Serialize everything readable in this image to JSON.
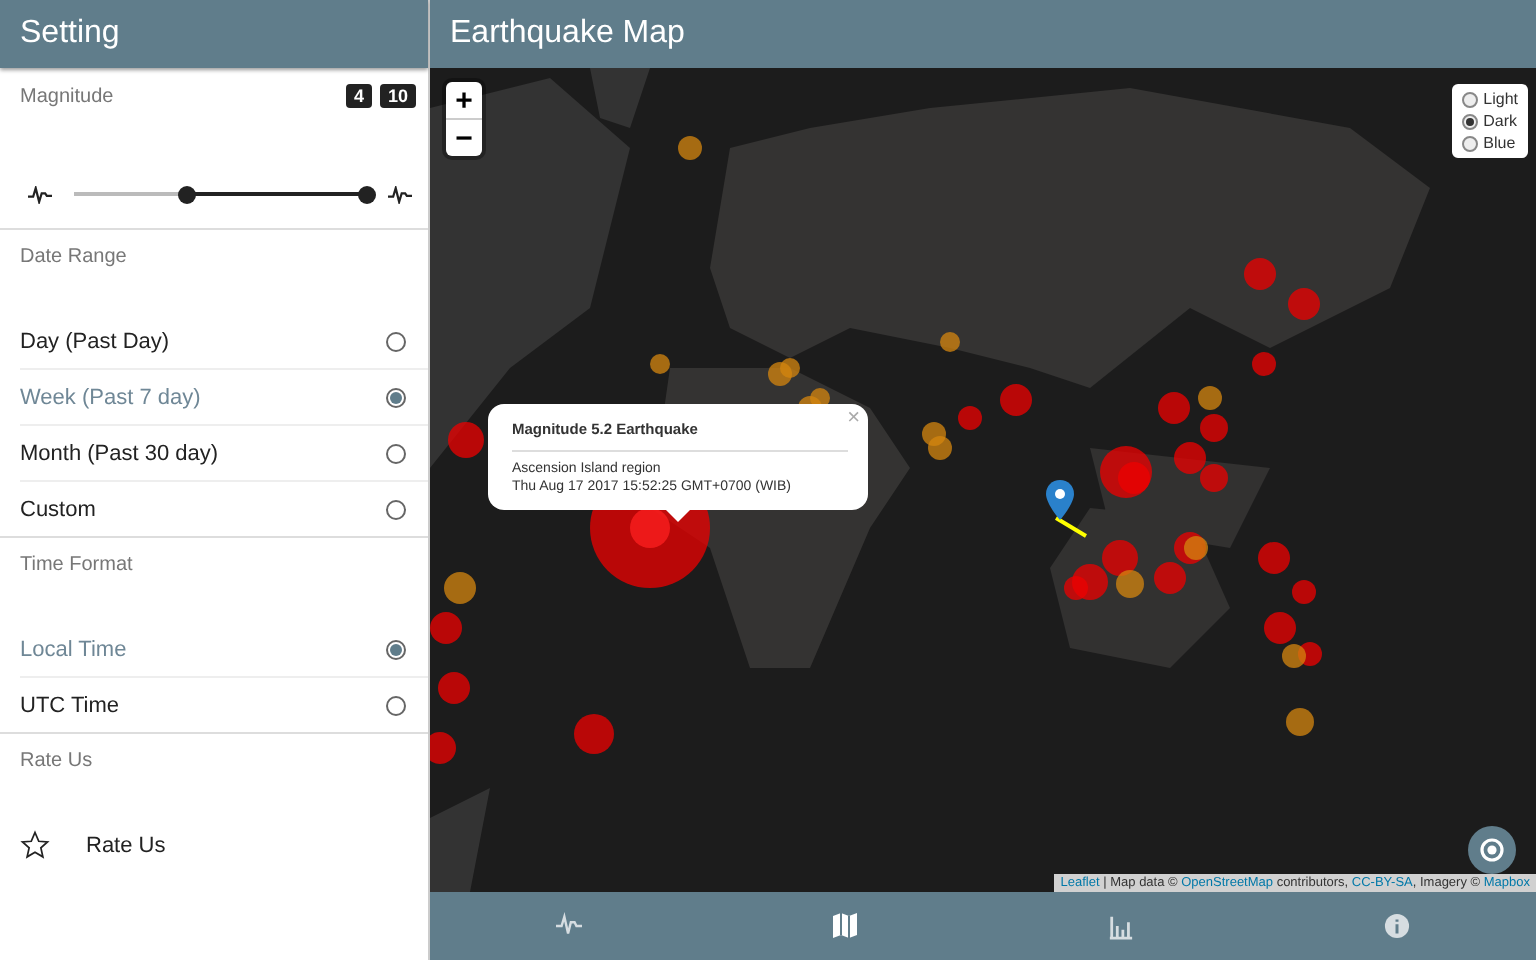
{
  "sidebar": {
    "title": "Setting",
    "magnitude": {
      "label": "Magnitude",
      "min_badge": "4",
      "max_badge": "10",
      "low_thumb": {
        "level": 0.39
      },
      "high_thumb": {
        "level": 1
      }
    },
    "date_range": {
      "label": "Date Range",
      "options": [
        {
          "label": "Day (Past Day)",
          "selected": false
        },
        {
          "label": "Week (Past 7 day)",
          "selected": true
        },
        {
          "label": "Month (Past 30 day)",
          "selected": false
        },
        {
          "label": "Custom",
          "selected": false
        }
      ]
    },
    "time_format": {
      "label": "Time Format",
      "options": [
        {
          "label": "Local Time",
          "selected": true
        },
        {
          "label": "UTC Time",
          "selected": false
        }
      ]
    },
    "rate": {
      "label": "Rate Us",
      "item": "Rate Us"
    }
  },
  "map": {
    "title": "Earthquake Map",
    "zoom_in": "+",
    "zoom_out": "−",
    "layers": [
      {
        "label": "Light",
        "selected": false
      },
      {
        "label": "Dark",
        "selected": true
      },
      {
        "label": "Blue",
        "selected": false
      }
    ],
    "popup": {
      "close": "×",
      "title": "Magnitude 5.2 Earthquake",
      "place": "Ascension Island region",
      "time": "Thu Aug 17 2017 15:52:25 GMT+0700 (WIB)"
    },
    "attribution": [
      {
        "kind": "link",
        "text": "Leaflet"
      },
      {
        "kind": "text",
        "text": " | Map data © "
      },
      {
        "kind": "link",
        "text": "OpenStreetMap"
      },
      {
        "kind": "text",
        "text": " contributors, "
      },
      {
        "kind": "link",
        "text": "CC-BY-SA"
      },
      {
        "kind": "text",
        "text": ", Imagery © "
      },
      {
        "kind": "link",
        "text": "Mapbox"
      }
    ]
  },
  "bottom_nav": [
    {
      "kind": "activity",
      "selected": false
    },
    {
      "kind": "map",
      "selected": true
    },
    {
      "kind": "chart",
      "selected": false
    },
    {
      "kind": "info",
      "selected": false
    }
  ]
}
